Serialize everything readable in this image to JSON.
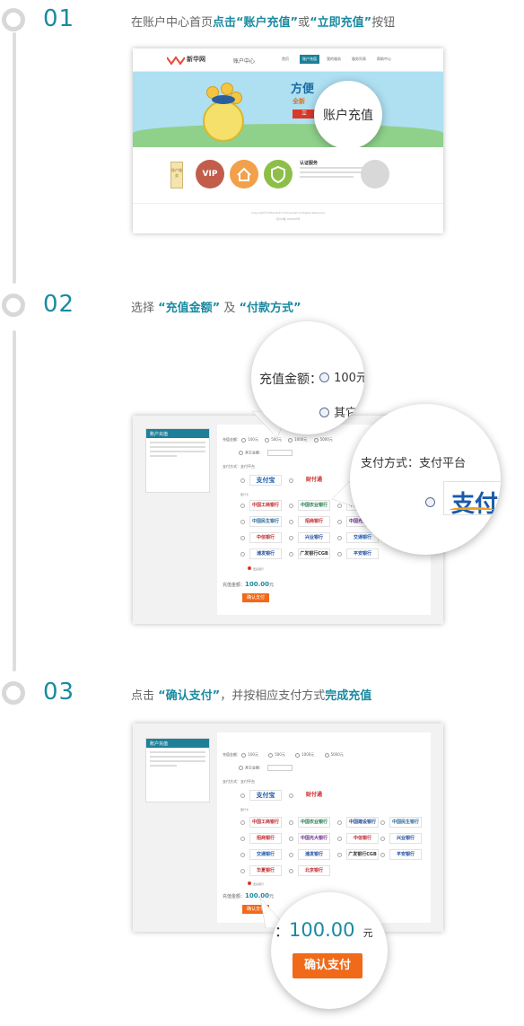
{
  "steps": [
    {
      "num": "01",
      "pre": "在账户中心首页",
      "b1": "点击“账户充值”",
      "mid": "或",
      "b2": "“立即充值”",
      "post": "按钮"
    },
    {
      "num": "02",
      "pre": "选择 ",
      "b1": "“充值金额”",
      "mid": " 及 ",
      "b2": "“付款方式”",
      "post": ""
    },
    {
      "num": "03",
      "pre": "点击 ",
      "b1": "“确认支付”",
      "mid": "，并按相应支付方式",
      "b2": "完成充值",
      "post": ""
    }
  ],
  "s1": {
    "logo_text": "新华网",
    "logo_sub": "www.xxx.com",
    "account_center": "账户中心",
    "nav": [
      "首页",
      "账户充值",
      "我的服务",
      "服务列表",
      "帮助中心"
    ],
    "banner_title": "方便",
    "banner_sub": "全新",
    "banner_btn": "立",
    "mag_label": "账户充值",
    "auth_title": "认证服务",
    "vip": "VIP",
    "tag_text": "账户服务",
    "footer1": "Copyright©2000-2013 Xinhua Net All Rights Reserved",
    "footer2": "京ICP备 000000号"
  },
  "s2": {
    "panel_title": "账户充值",
    "mag1_label": "充值金额：",
    "mag1_opt1": "100元",
    "mag1_opt2": "其它金",
    "mag2_label": "支付方式：支付平台",
    "mag2_logo": "支付"
  },
  "s3": {
    "panel_title": "账户充值",
    "amount_label": "充值金额：",
    "amount_value": "100.00",
    "amount_unit": "元",
    "mag_prefix": "：",
    "confirm_btn": "确认支付"
  },
  "form": {
    "amounts": [
      "100元",
      "500元",
      "1000元",
      "5000元"
    ],
    "other": "其它金额：",
    "pay_method": "支付方式：支付平台",
    "alipay": "支付宝",
    "tenpay": "财付通",
    "bank_card": "银行卡",
    "banks": [
      "中国工商银行",
      "中国农业银行",
      "中国建设银行",
      "中国民生银行",
      "招商银行",
      "中国光大银行",
      "中信银行",
      "兴业银行",
      "交通银行",
      "浦发银行",
      "广发银行CGB",
      "平安银行",
      "华夏银行",
      "北京银行"
    ],
    "more_banks": "更多银行"
  },
  "colors": {
    "teal": "#1a8aa0",
    "orange": "#f06a1a",
    "gray": "#dedede"
  }
}
